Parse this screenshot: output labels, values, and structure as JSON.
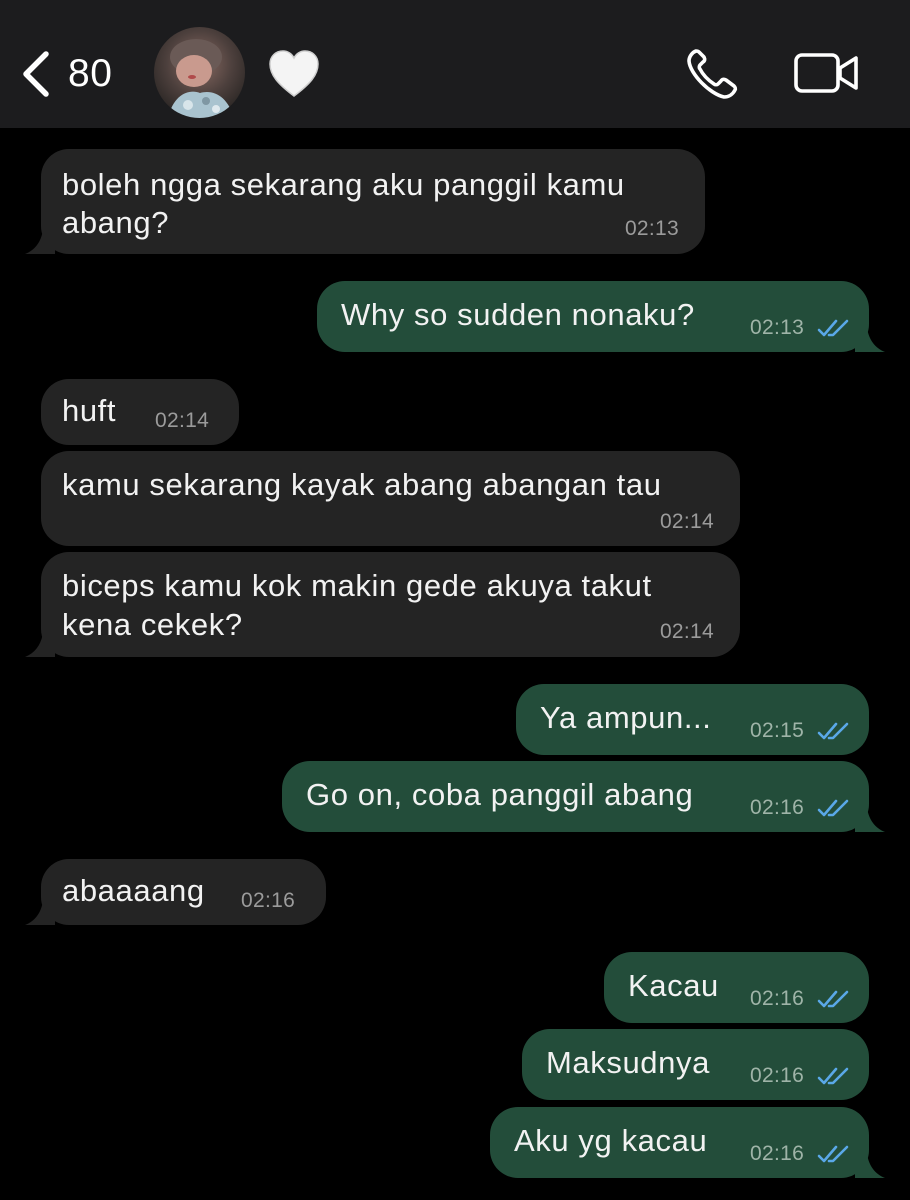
{
  "header": {
    "unread_count": "80",
    "contact_emoji": "🤍"
  },
  "colors": {
    "header_bg": "#1c1c1e",
    "incoming_bubble": "#242424",
    "outgoing_bubble": "#234d3a",
    "read_ticks": "#5aa8e8"
  },
  "messages": [
    {
      "direction": "incoming",
      "lines": [
        "boleh ngga sekarang aku panggil kamu",
        "abang?"
      ],
      "time": "02:13"
    },
    {
      "direction": "outgoing",
      "lines": [
        "Why so sudden nonaku?"
      ],
      "time": "02:13",
      "status": "read"
    },
    {
      "direction": "incoming",
      "lines": [
        "huft"
      ],
      "time": "02:14"
    },
    {
      "direction": "incoming",
      "lines": [
        "kamu sekarang kayak abang abangan tau"
      ],
      "time": "02:14"
    },
    {
      "direction": "incoming",
      "lines": [
        "biceps kamu kok makin gede akuya takut",
        "kena cekek?"
      ],
      "time": "02:14"
    },
    {
      "direction": "outgoing",
      "lines": [
        "Ya ampun..."
      ],
      "time": "02:15",
      "status": "read"
    },
    {
      "direction": "outgoing",
      "lines": [
        "Go on, coba panggil abang"
      ],
      "time": "02:16",
      "status": "read"
    },
    {
      "direction": "incoming",
      "lines": [
        "abaaaang"
      ],
      "time": "02:16"
    },
    {
      "direction": "outgoing",
      "lines": [
        "Kacau"
      ],
      "time": "02:16",
      "status": "read"
    },
    {
      "direction": "outgoing",
      "lines": [
        "Maksudnya"
      ],
      "time": "02:16",
      "status": "read"
    },
    {
      "direction": "outgoing",
      "lines": [
        "Aku yg kacau"
      ],
      "time": "02:16",
      "status": "read"
    }
  ]
}
